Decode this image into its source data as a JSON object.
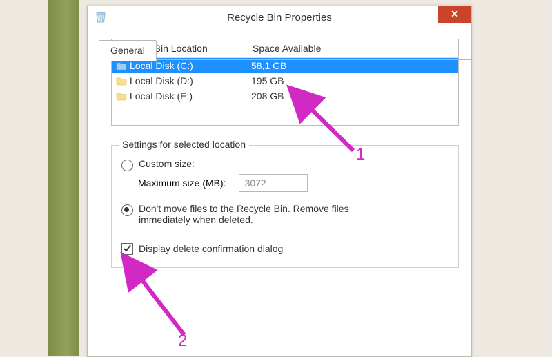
{
  "window": {
    "title": "Recycle Bin Properties",
    "close_glyph": "✕"
  },
  "tabs": {
    "general": "General"
  },
  "columns": {
    "location": "Recycle Bin Location",
    "space": "Space Available"
  },
  "drives": [
    {
      "name": "Local Disk (C:)",
      "space": "58,1 GB",
      "selected": true
    },
    {
      "name": "Local Disk (D:)",
      "space": "195 GB",
      "selected": false
    },
    {
      "name": "Local Disk (E:)",
      "space": "208 GB",
      "selected": false
    }
  ],
  "group": {
    "title": "Settings for selected location",
    "custom_size_label": "Custom size:",
    "max_size_label": "Maximum size (MB):",
    "max_size_value": "3072",
    "dont_move_label": "Don't move files to the Recycle Bin. Remove files immediately when deleted.",
    "selected_option": "dont_move"
  },
  "confirm": {
    "label": "Display delete confirmation dialog",
    "checked": true
  },
  "annotations": {
    "one": "1",
    "two": "2"
  },
  "colors": {
    "selection": "#1e90ff",
    "close_btn": "#c9442a",
    "annotation": "#d329c4"
  }
}
